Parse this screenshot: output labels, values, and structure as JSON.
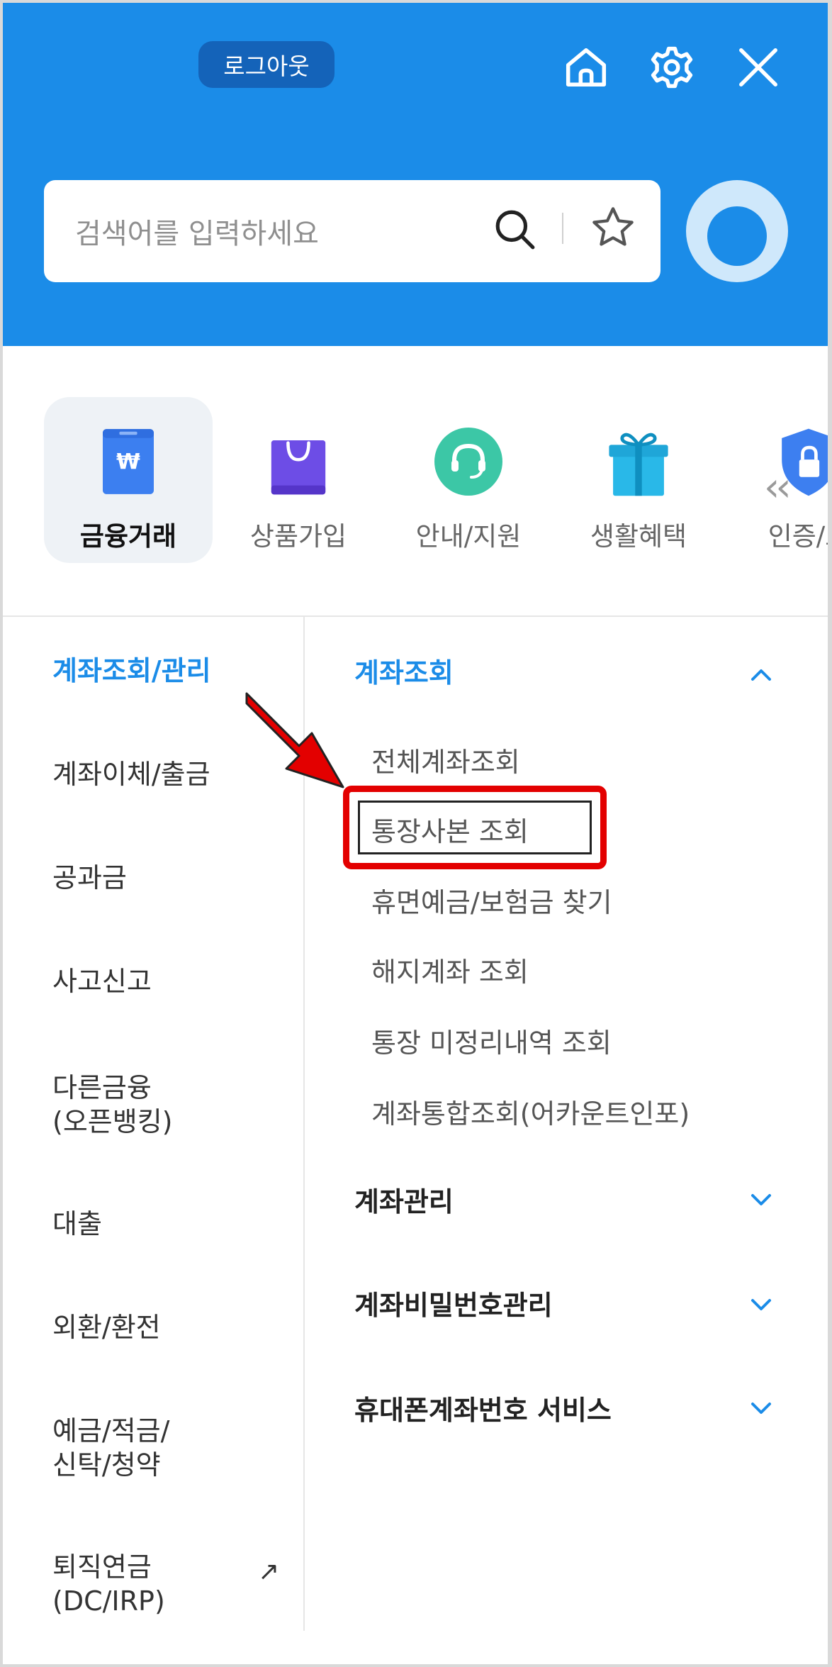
{
  "header": {
    "logout_label": "로그아웃",
    "icons": [
      "home-icon",
      "gear-icon",
      "close-icon"
    ],
    "background_color": "#1b8ce8"
  },
  "search": {
    "placeholder": "검색어를 입력하세요",
    "icons": [
      "search-icon",
      "star-icon"
    ]
  },
  "categories": [
    {
      "label": "금융거래",
      "icon": "wallet-won-icon",
      "active": true
    },
    {
      "label": "상품가입",
      "icon": "shopping-bag-icon",
      "active": false
    },
    {
      "label": "안내/지원",
      "icon": "headset-icon",
      "active": false
    },
    {
      "label": "생활혜택",
      "icon": "gift-icon",
      "active": false
    },
    {
      "label": "인증/보",
      "icon": "shield-lock-icon",
      "active": false
    }
  ],
  "category_scroll_icon": "double-chevron-left-icon",
  "sidebar": {
    "items": [
      {
        "label": "계좌조회/관리",
        "active": true
      },
      {
        "label": "계좌이체/출금"
      },
      {
        "label": "공과금"
      },
      {
        "label": "사고신고"
      },
      {
        "label": "다른금융\n(오픈뱅킹)"
      },
      {
        "label": "대출"
      },
      {
        "label": "외환/환전"
      },
      {
        "label": "예금/적금/\n신탁/청약"
      },
      {
        "label": "퇴직연금\n(DC/IRP)",
        "external": true
      }
    ],
    "external_icon": "↗"
  },
  "sections": [
    {
      "title": "계좌조회",
      "expanded": true,
      "items": [
        "전체계좌조회",
        "통장사본 조회",
        "휴면예금/보험금 찾기",
        "해지계좌 조회",
        "통장 미정리내역 조회",
        "계좌통합조회(어카운트인포)"
      ]
    },
    {
      "title": "계좌관리",
      "expanded": false
    },
    {
      "title": "계좌비밀번호관리",
      "expanded": false
    },
    {
      "title": "휴대폰계좌번호 서비스",
      "expanded": false
    }
  ],
  "annotation": {
    "highlighted_item": "통장사본 조회",
    "color": "#e30000"
  },
  "colors": {
    "accent": "#1b8ce8",
    "logout_bg": "#1463b9",
    "annotation_red": "#e30000"
  }
}
